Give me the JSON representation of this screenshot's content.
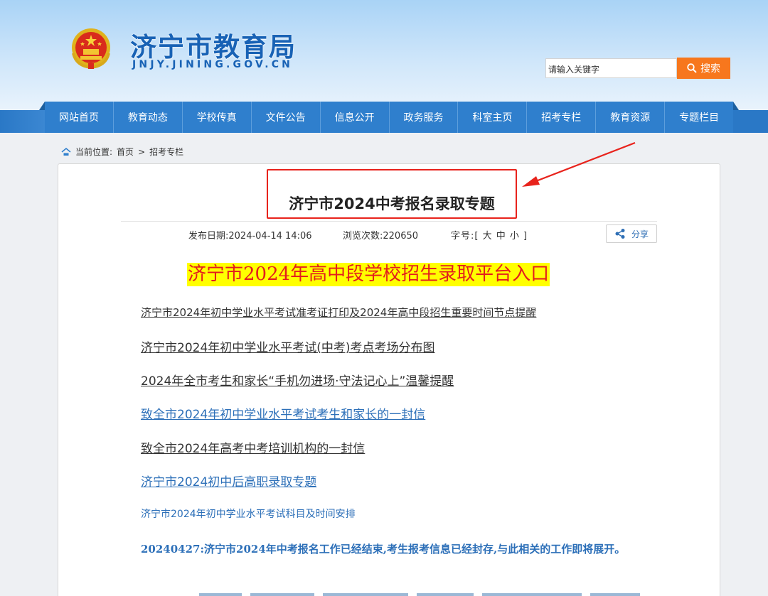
{
  "header": {
    "site_title": "济宁市教育局",
    "site_subtitle": "JNJY.JINING.GOV.CN",
    "emblem_icon": "national-emblem-icon",
    "search": {
      "placeholder": "请输入关键字",
      "button_label": "搜索",
      "button_icon": "search-icon"
    }
  },
  "nav": {
    "items": [
      "网站首页",
      "教育动态",
      "学校传真",
      "文件公告",
      "信息公开",
      "政务服务",
      "科室主页",
      "招考专栏",
      "教育资源",
      "专题栏目"
    ]
  },
  "breadcrumb": {
    "icon": "home-icon",
    "prefix": "当前位置:",
    "home": "首页",
    "separator": ">",
    "current": "招考专栏"
  },
  "article": {
    "title": "济宁市2024中考报名录取专题",
    "publish_date": "发布日期:2024-04-14 14:06",
    "views": "浏览次数:220650",
    "font_size": "字号:[ 大 中 小 ]",
    "share_label": "分享",
    "share_icon": "share-icon",
    "banner_link": "济宁市2024年高中段学校招生录取平台入口",
    "links": [
      "济宁市2024年初中学业水平考试准考证打印及2024年高中段招生重要时间节点提醒",
      "济宁市2024年初中学业水平考试(中考)考点考场分布图",
      "2024年全市考生和家长“手机勿进场·守法记心上”温馨提醒",
      "致全市2024年初中学业水平考试考生和家长的一封信",
      "致全市2024年高考中考培训机构的一封信",
      "济宁市2024初中后高职录取专题",
      "济宁市2024年初中学业水平考试科目及时间安排"
    ],
    "notice": "20240427:济宁市2024年中考报名工作已经结束,考生报考信息已经封存,与此相关的工作即将展开。"
  },
  "colors": {
    "brand_blue": "#2f7fcd",
    "search_orange": "#f7771d",
    "banner_yellow": "#ffff00",
    "banner_red": "#e31d1d",
    "annotation_red": "#e8231c",
    "notice_blue": "#2c6fb8"
  }
}
